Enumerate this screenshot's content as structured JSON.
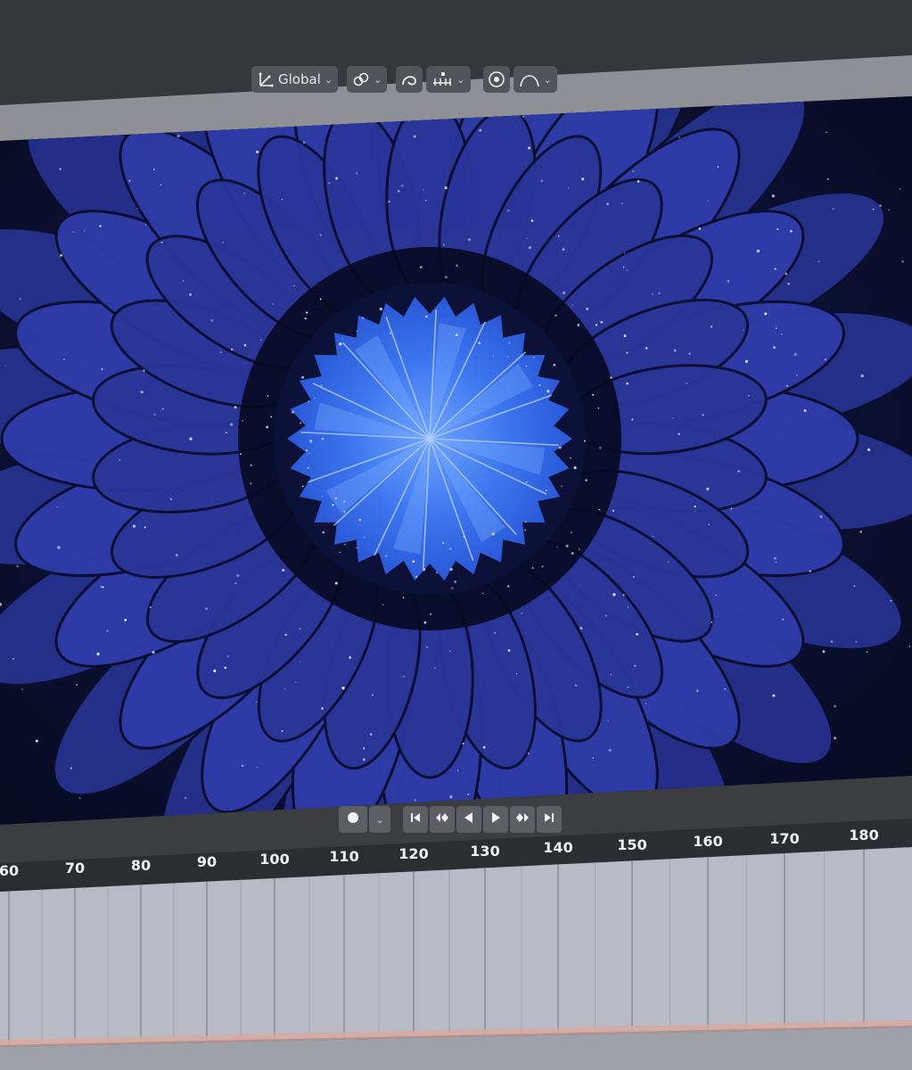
{
  "header": {
    "orientation": {
      "icon": "transform-orientation-icon",
      "label": "Global",
      "chevron": "⌄"
    },
    "pivot": {
      "icon": "pivot-point-icon",
      "chevron": "⌄"
    },
    "snap": {
      "icon": "snap-magnet-icon"
    },
    "snap_target": {
      "icon": "snap-increment-icon",
      "chevron": "⌄"
    },
    "proportional": {
      "icon": "proportional-edit-icon"
    },
    "falloff": {
      "icon": "falloff-curve-icon",
      "chevron": "⌄"
    }
  },
  "playback": {
    "record": {
      "icon": "record-icon",
      "chevron": "⌄"
    },
    "buttons": [
      {
        "name": "jump-to-start-icon"
      },
      {
        "name": "jump-to-keyframe-prev-icon"
      },
      {
        "name": "play-reverse-icon"
      },
      {
        "name": "play-icon"
      },
      {
        "name": "jump-to-keyframe-next-icon"
      },
      {
        "name": "jump-to-end-icon"
      }
    ]
  },
  "timeline": {
    "frames": [
      "60",
      "70",
      "80",
      "90",
      "100",
      "110",
      "120",
      "130",
      "140",
      "150",
      "160",
      "170",
      "180"
    ]
  },
  "colors": {
    "viewport_bg": "#0c1030",
    "petal": "#2e3aa0",
    "center": "#3a78ee",
    "panel": "#b9bcc5"
  }
}
